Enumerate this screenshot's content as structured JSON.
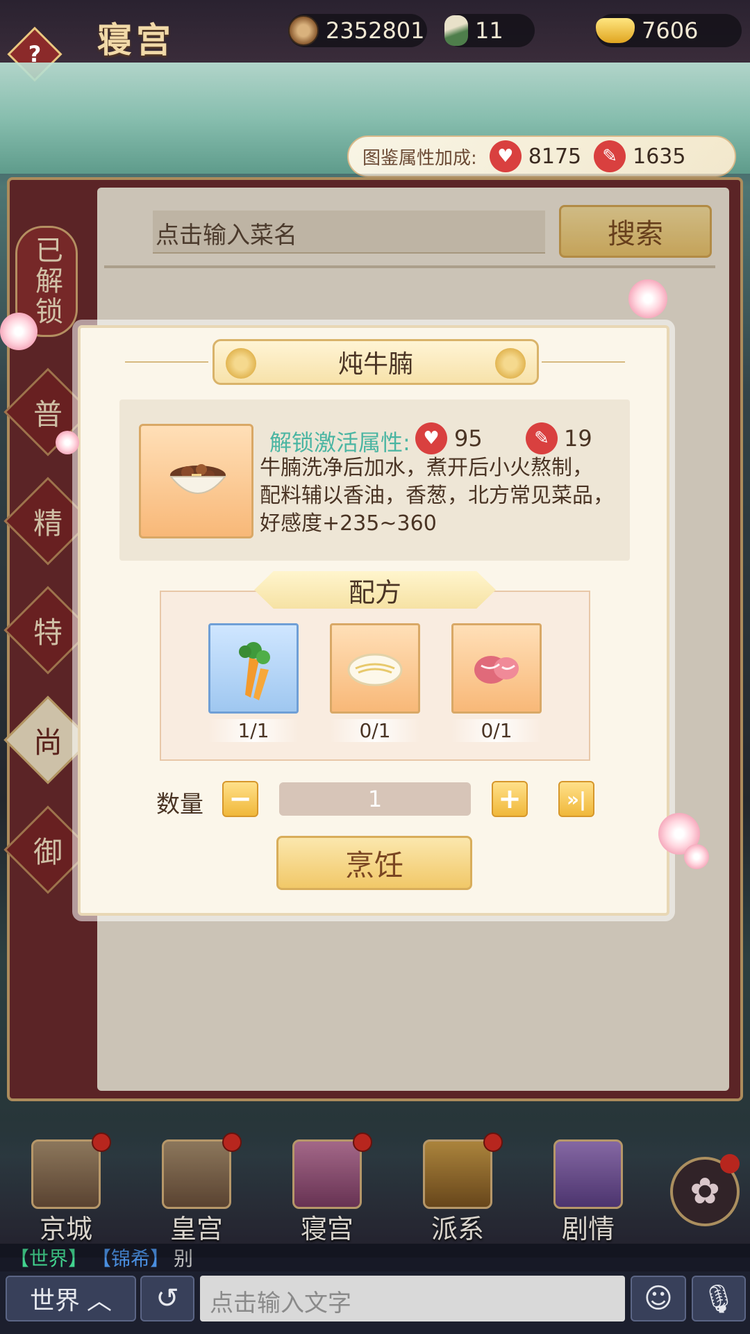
{
  "topbar": {
    "help_icon": "?",
    "title": "寝宫",
    "coins": "2352801",
    "potions": "11",
    "gold": "7606"
  },
  "album_bonus": {
    "label": "图鉴属性加成:",
    "charm_value": "8175",
    "talent_value": "1635",
    "charm_icon": "heart-icon",
    "talent_icon": "brush-icon"
  },
  "search": {
    "placeholder": "点击输入菜名",
    "button": "搜索"
  },
  "categories": {
    "unlocked": "已解锁",
    "items": [
      "普",
      "精",
      "特",
      "尚",
      "御"
    ],
    "active": "尚"
  },
  "dialog": {
    "title": "炖牛腩",
    "attr_label": "解锁激活属性:",
    "charm": "95",
    "talent": "19",
    "desc_line1": "牛腩洗净后加水，煮开后小火熬制，",
    "desc_line2": "配料辅以香油，香葱，北方常见菜品，",
    "desc_line3": "好感度+235~360",
    "recipe_title": "配方",
    "ingredients": [
      {
        "name": "carrot",
        "count": "1/1"
      },
      {
        "name": "noodles",
        "count": "0/1"
      },
      {
        "name": "meat",
        "count": "0/1"
      }
    ],
    "qty_label": "数量",
    "qty_minus": "−",
    "qty_value": "1",
    "qty_plus": "+",
    "qty_max": "»|",
    "cook_button": "烹饪"
  },
  "nav": {
    "items": [
      "京城",
      "皇宫",
      "寝宫",
      "派系",
      "剧情"
    ]
  },
  "chat": {
    "channel_tag": "【世界】",
    "user_tag": "【锦希】",
    "message": "别",
    "channel_button": "世界",
    "input_placeholder": "点击输入文字"
  },
  "colors": {
    "accent_gold": "#f1c868",
    "panel_red": "#7b2627",
    "teal_label": "#4ab5a2"
  }
}
